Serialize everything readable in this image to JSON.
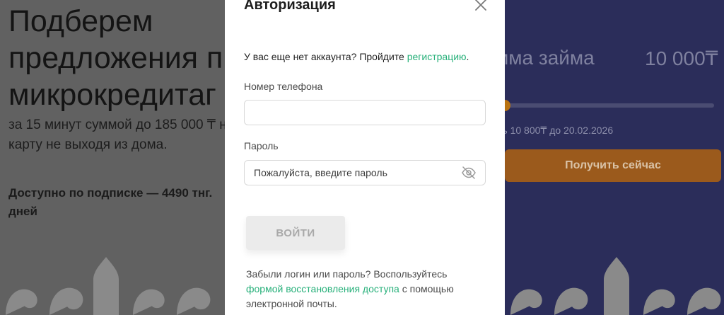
{
  "hero": {
    "title_lines": [
      "Подберем",
      "предложения п",
      "микрокредитаг"
    ],
    "subtitle_lines": [
      "за 15 минут суммой до 185 000 ₸ на",
      "карту не выходя из дома."
    ],
    "offer_lines": [
      "Доступно по подписке — 4490 тнг.",
      "дней"
    ]
  },
  "calculator": {
    "loan_label": "мма займа",
    "loan_amount": "10 000₸",
    "slider_fraction": 0.0,
    "repay_text": "ть 10 800₸ до 20.02.2026",
    "cta_label": "Получить сейчас"
  },
  "modal": {
    "title": "Авторизация",
    "close_icon": "close-icon",
    "signup_prefix": "У вас еще нет аккаунта? Пройдите",
    "signup_link": "регистрацию",
    "signup_suffix": ".",
    "phone_label": "Номер телефона",
    "phone_value": "",
    "phone_placeholder": "",
    "password_label": "Пароль",
    "password_placeholder": "Пожалуйста, введите пароль",
    "password_toggle_icon": "eye-off-icon",
    "login_button": "ВОЙТИ",
    "recover_prefix": "Забыли логин или пароль? Воспользуйтесь",
    "recover_link": "формой восстановления доступа",
    "recover_suffix": "с помощью электронной почты."
  },
  "colors": {
    "link": "#27b07a",
    "overlay_left": "#616161",
    "panel_right": "#2b2d5a",
    "cta": "#9b5a1c"
  }
}
